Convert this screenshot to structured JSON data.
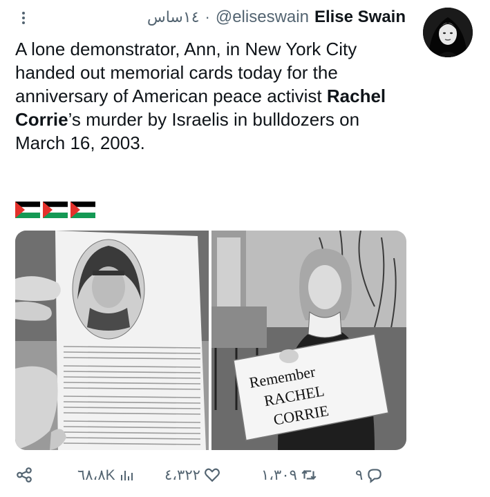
{
  "header": {
    "display_name": "Elise Swain",
    "handle": "@eliseswain",
    "separator": "·",
    "time": "١٤ساس"
  },
  "tweet": {
    "text_before_name": "A lone demonstrator, Ann, in New York City handed out memorial cards today for the anniversary of American peace activist ",
    "bold_name": "Rachel Corrie",
    "text_after_name": "’s murder by Israelis in bulldozers on March 16, 2003.",
    "flags": [
      "palestine-flag",
      "palestine-flag",
      "palestine-flag"
    ]
  },
  "media": {
    "left_image": "memorial card held in hand",
    "right_image": "woman holding cardboard sign",
    "sign_text": [
      "Remember",
      "RACHEL",
      "CORRIE"
    ]
  },
  "actions": {
    "replies": "٩",
    "retweets": "١،٣٠٩",
    "likes": "٤،٣٢٢",
    "views": "٦٨،٨K"
  },
  "colors": {
    "text": "#0f1419",
    "secondary": "#536471",
    "background": "#ffffff"
  }
}
